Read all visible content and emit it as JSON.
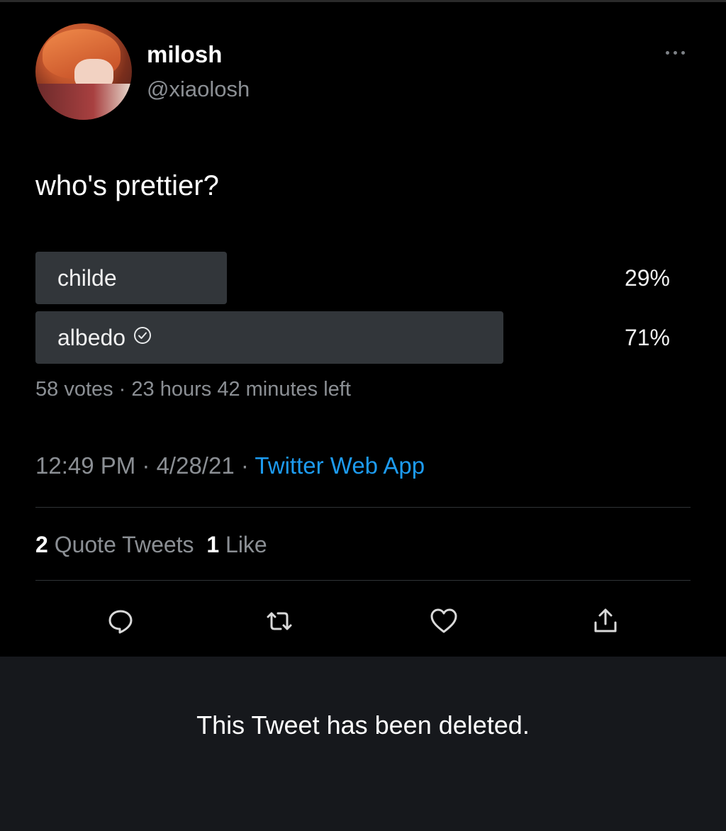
{
  "tweet": {
    "author": {
      "display_name": "milosh",
      "handle": "@xiaolosh"
    },
    "text": "who's prettier?",
    "poll": {
      "options": [
        {
          "label": "childe",
          "percent_text": "29%",
          "percent": 29,
          "selected": false
        },
        {
          "label": "albedo",
          "percent_text": "71%",
          "percent": 71,
          "selected": true
        }
      ],
      "meta": "58 votes · 23 hours 42 minutes left"
    },
    "timestamp": {
      "time_date": "12:49 PM · 4/28/21 · ",
      "source": "Twitter Web App"
    },
    "stats": {
      "quote_count": "2",
      "quote_label": "Quote Tweets",
      "like_count": "1",
      "like_label": "Like"
    },
    "actions": [
      "reply-icon",
      "retweet-icon",
      "like-icon",
      "share-icon"
    ]
  },
  "deleted_notice": "This Tweet has been deleted.",
  "colors": {
    "background": "#000000",
    "poll_bar": "#32363a",
    "link": "#1d9bf0",
    "muted": "#8b8f94",
    "notice_bg": "#16181c"
  }
}
